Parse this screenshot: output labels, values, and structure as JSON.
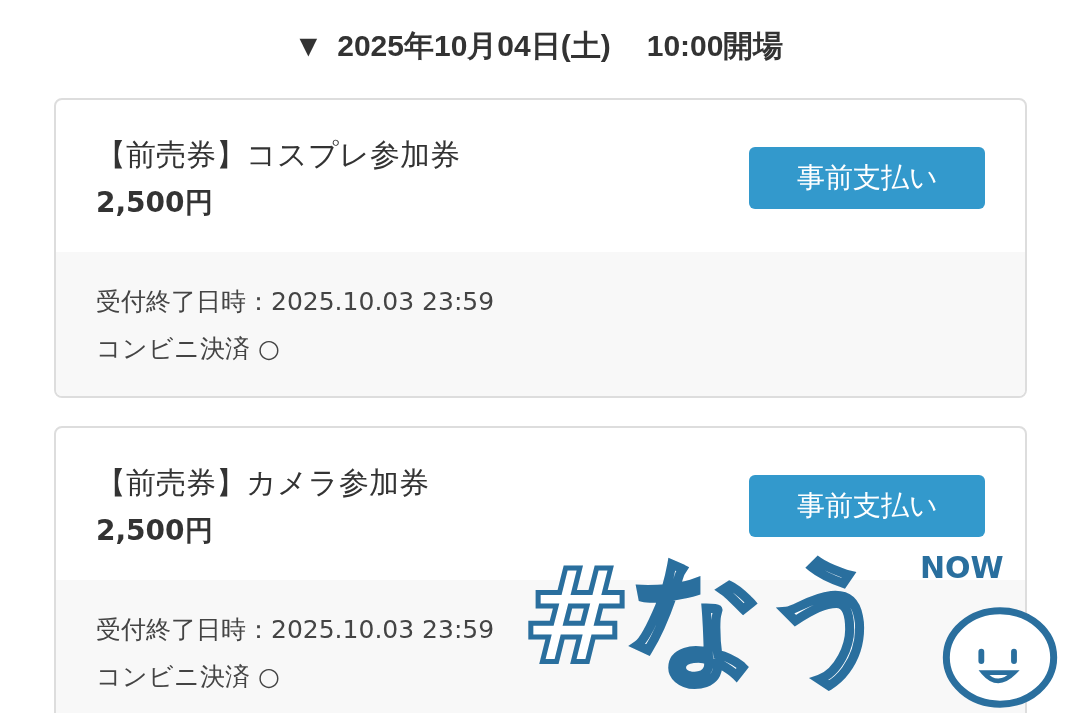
{
  "header": {
    "marker": "▼",
    "date": "2025年10月04日(土)",
    "open_time": "10:00開場"
  },
  "tickets": [
    {
      "title": "【前売券】コスプレ参加券",
      "price": "2,500円",
      "button": "事前支払い",
      "deadline": "受付終了日時：2025.10.03 23:59",
      "payment": "コンビニ決済 ○"
    },
    {
      "title": "【前売券】カメラ参加券",
      "price": "2,500円",
      "button": "事前支払い",
      "deadline": "受付終了日時：2025.10.03 23:59",
      "payment": "コンビニ決済 ○"
    }
  ],
  "sticker": {
    "text": "#なう",
    "tag": "NOW"
  }
}
